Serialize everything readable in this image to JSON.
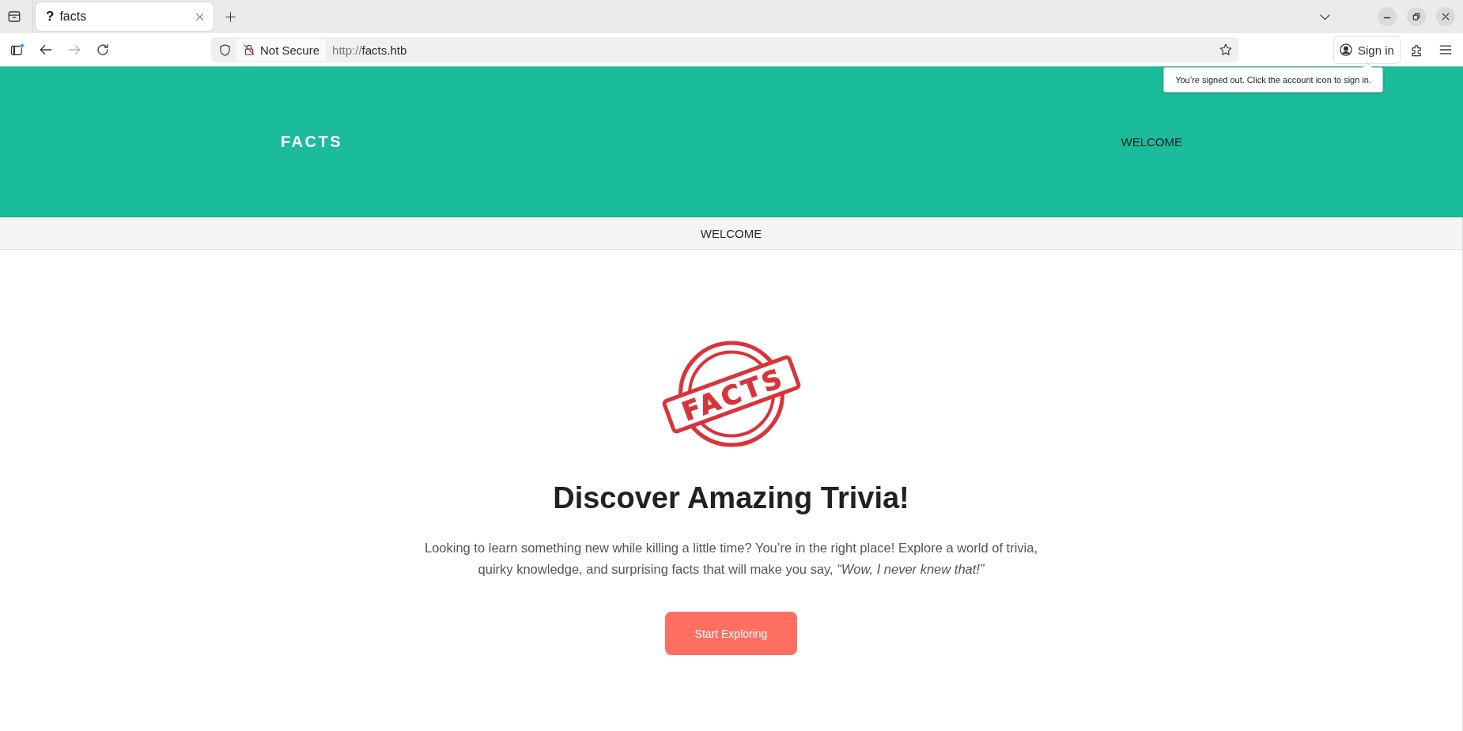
{
  "browser": {
    "tabs": [
      {
        "icon": "?",
        "title": "facts",
        "selected": true
      }
    ],
    "toolbar": [
      {
        "kind": "sidebar",
        "disabled": false
      },
      {
        "kind": "back",
        "disabled": false
      },
      {
        "kind": "forward",
        "disabled": true
      },
      {
        "kind": "reload",
        "disabled": false
      }
    ],
    "security_label": "Not Secure",
    "url": {
      "scheme": "http://",
      "host": "facts.htb"
    },
    "sign_in": "Sign in",
    "tooltip": "You’re signed out. Click the account icon to sign in."
  },
  "site": {
    "brand": "FACTS",
    "nav": [
      {
        "label": "WELCOME"
      }
    ],
    "subnav": [
      {
        "label": "WELCOME"
      }
    ]
  },
  "hero": {
    "logo_text": "FACTS",
    "heading": "Discover Amazing Trivia!",
    "text": "Looking to learn something new while killing a little time? You’re in the right place! Explore a world of trivia, quirky knowledge, and surprising facts that will make you say, *“Wow, I never knew that!”*",
    "button": "Start Exploring"
  }
}
